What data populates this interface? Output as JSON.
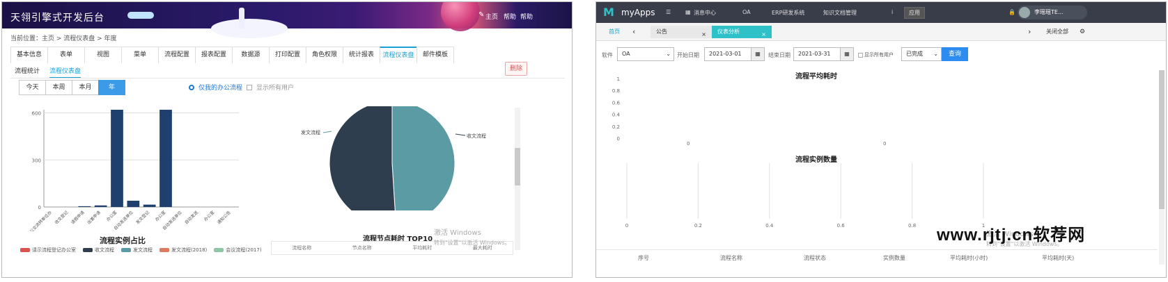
{
  "left": {
    "title": "天翎引擎式开发后台",
    "header_links": [
      "主页",
      "帮助",
      "帮助"
    ],
    "breadcrumb": "当前位置：主页 > 流程仪表盘 > 年度",
    "tabs": [
      "基本信息",
      "表单",
      "视图",
      "菜单",
      "流程配置",
      "报表配置",
      "数据源",
      "打印配置",
      "角色权限",
      "统计报表",
      "流程仪表盘",
      "邮件模板"
    ],
    "active_tab_index": 10,
    "subtabs": [
      "流程统计",
      "流程仪表盘"
    ],
    "active_subtab_index": 1,
    "delete_label": "删除",
    "period_buttons": [
      "今天",
      "本周",
      "本月",
      "年"
    ],
    "active_period_index": 3,
    "options": [
      "仅我的办公流程",
      "显示所有用户"
    ],
    "bar_chart_title": "流程实例占比",
    "bar_axis_ticks": [
      "600",
      "300",
      "0"
    ],
    "bar_categories": [
      "公文流转单位办",
      "收文登记",
      "请假申请",
      "出差申请",
      "办公室",
      "自动发送单位",
      "发文登记",
      "办公室",
      "自动发送单位",
      "自动发送",
      "办公室",
      "通知公告"
    ],
    "legend": [
      {
        "label": "请示流程登记办公室",
        "color": "#d9534f"
      },
      {
        "label": "收文流程",
        "color": "#2f3e4e"
      },
      {
        "label": "发文流程",
        "color": "#5b9ba4"
      },
      {
        "label": "发文流程(2018)",
        "color": "#e07a5f"
      },
      {
        "label": "会议流程(2017)",
        "color": "#8fc6a6"
      }
    ],
    "pie_labels": [
      "发文流程",
      "收文流程"
    ],
    "top10_title": "流程节点耗时 TOP10",
    "table_headers": [
      "流程名称",
      "节点名称",
      "平均耗时",
      "最大耗时"
    ],
    "watermark": [
      "激活 Windows",
      "转到\"设置\"以激活 Windows。"
    ]
  },
  "right": {
    "app_name": "myApps",
    "nav": [
      "消息中心",
      "OA",
      "ERP研发系统",
      "知识文档管理",
      "i",
      "应用"
    ],
    "user_name": "李瑶瑶TE...",
    "tabs": [
      "首页",
      "公告",
      "仪表分析"
    ],
    "more_tab": "关闭全部",
    "filter": {
      "software_label": "软件",
      "software_value": "OA",
      "start_label": "开始日期",
      "start_value": "2021-03-01",
      "end_label": "结束日期",
      "end_value": "2021-03-31",
      "show_all_label": "显示所有用户",
      "flow_select": "已完成",
      "query_label": "查询"
    },
    "chart1_title": "流程平均耗时",
    "chart1_y_ticks": [
      "1",
      "0.8",
      "0.6",
      "0.4",
      "0.2",
      "0"
    ],
    "chart1_x_labels": [
      "0",
      "0"
    ],
    "chart2_title": "流程实例数量",
    "chart2_x_ticks": [
      "0",
      "0.2",
      "0.4",
      "0.6",
      "0.8",
      "1"
    ],
    "table_headers": [
      "序号",
      "流程名称",
      "流程状态",
      "实例数量",
      "平均耗时(小时)",
      "平均耗时(天)"
    ],
    "watermark": [
      "激活 Windows",
      "转到\"设置\"以激活 Windows。"
    ]
  },
  "site_watermark": "www.rjtj.cn软荐网",
  "chart_data": [
    {
      "type": "bar",
      "title": "流程实例占比",
      "categories": [
        "公文流转单位办",
        "收文登记",
        "请假申请",
        "出差申请",
        "办公室",
        "自动发送单位",
        "发文登记",
        "办公室",
        "自动发送单位",
        "自动发送",
        "办公室",
        "通知公告"
      ],
      "values": [
        0,
        0,
        5,
        10,
        620,
        40,
        15,
        620,
        0,
        0,
        0,
        0
      ],
      "ylim": [
        0,
        620
      ],
      "yticks": [
        0,
        300,
        600
      ]
    },
    {
      "type": "pie",
      "labels": [
        "发文流程",
        "收文流程"
      ],
      "values": [
        49,
        51
      ],
      "colors": [
        "#5b9ba4",
        "#2f3e4e"
      ]
    },
    {
      "type": "line",
      "title": "流程平均耗时",
      "ylim": [
        0,
        1
      ],
      "series": []
    },
    {
      "type": "bar",
      "title": "流程实例数量",
      "xlim": [
        0,
        1
      ],
      "series": []
    }
  ]
}
